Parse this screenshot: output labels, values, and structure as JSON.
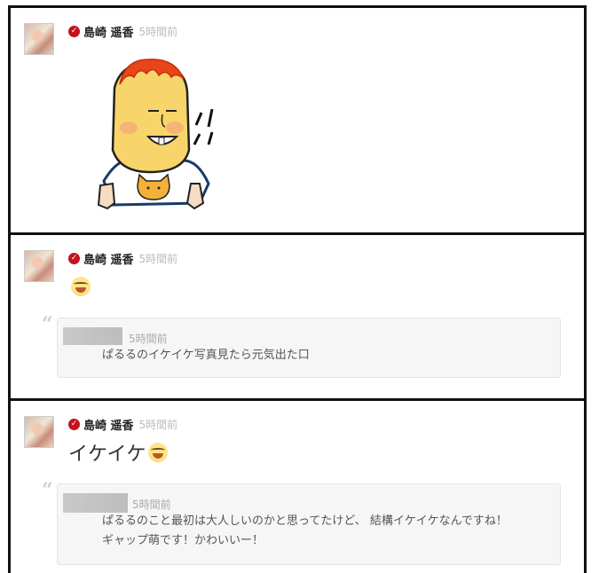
{
  "posts": [
    {
      "author": "島崎 遥香",
      "time": "5時間前",
      "sticker": "illustrated-character-sticker"
    },
    {
      "author": "島崎 遥香",
      "time": "5時間前",
      "body_emoji": "laughing-tears-emoji",
      "quote": {
        "time": "5時間前",
        "text": "ぱるるのイケイケ写真見たら元気出た口"
      }
    },
    {
      "author": "島崎 遥香",
      "time": "5時間前",
      "body_text": "イケイケ",
      "body_emoji": "laughing-tears-emoji",
      "quote": {
        "time": "5時間前",
        "line1": "ぱるるのこと最初は大人しいのかと思ってたけど、 結構イケイケなんですね！",
        "line2": "ギャップ萌です！かわいいー！"
      }
    }
  ],
  "colors": {
    "verified": "#c4121d",
    "border": "#111111",
    "quote_bg": "#f6f6f6"
  }
}
